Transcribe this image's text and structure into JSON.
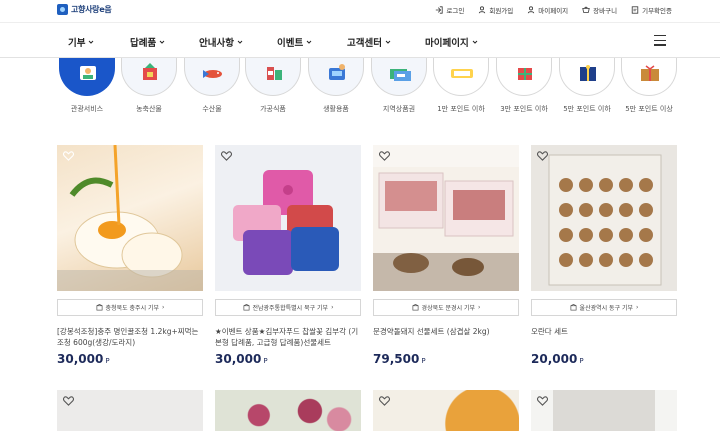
{
  "header": {
    "logo_text": "고향사랑e음",
    "utils": [
      {
        "label": "로그인",
        "icon": "login-icon"
      },
      {
        "label": "회원가입",
        "icon": "user-icon"
      },
      {
        "label": "마이페이지",
        "icon": "user-icon"
      },
      {
        "label": "장바구니",
        "icon": "cart-icon"
      },
      {
        "label": "기부확인증",
        "icon": "document-icon"
      }
    ]
  },
  "nav": {
    "items": [
      "기부",
      "답례품",
      "안내사항",
      "이벤트",
      "고객센터",
      "마이페이지"
    ]
  },
  "categories": [
    {
      "label": "관광서비스",
      "active": true
    },
    {
      "label": "농축산물",
      "active": false
    },
    {
      "label": "수산물",
      "active": false
    },
    {
      "label": "가공식품",
      "active": false
    },
    {
      "label": "생활용품",
      "active": false
    },
    {
      "label": "지역상품권",
      "active": false
    },
    {
      "label": "1만 포인트 이하",
      "active": false
    },
    {
      "label": "3만 포인트 이하",
      "active": false
    },
    {
      "label": "5만 포인트 이하",
      "active": false
    },
    {
      "label": "5만 포인트 이상",
      "active": false
    }
  ],
  "products": [
    {
      "region": "충청북도 충주시 기부",
      "name": "[강봉석조청]충주 명인꿀조청 1.2kg+찌먹는 조청 600g(생강/도라지)",
      "price": "30,000",
      "unit": "P"
    },
    {
      "region": "전남광주통합특별시 북구 기부",
      "name": "★이벤트 상품★김부자푸드 찹쌀꽃 김부각 (기본형 답례품, 고급형 답례품)선물세트",
      "price": "30,000",
      "unit": "P"
    },
    {
      "region": "경상북도 문경시 기부",
      "name": "문경약돌돼지 선물세트 (삼겹살 2kg)",
      "price": "79,500",
      "unit": "P"
    },
    {
      "region": "울산광역시 동구 기부",
      "name": "오란다 세트",
      "price": "20,000",
      "unit": "P"
    }
  ],
  "colors": {
    "accent": "#1a56c9",
    "price": "#1d2a5a"
  }
}
